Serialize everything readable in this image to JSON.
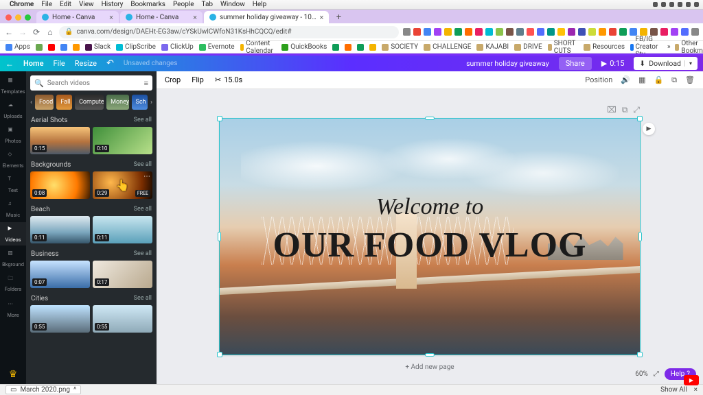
{
  "mac_menu": {
    "app": "Chrome",
    "items": [
      "File",
      "Edit",
      "View",
      "History",
      "Bookmarks",
      "People",
      "Tab",
      "Window",
      "Help"
    ]
  },
  "tabs": [
    {
      "title": "Home - Canva"
    },
    {
      "title": "Home - Canva"
    },
    {
      "title": "summer holiday giveaway - 10…"
    }
  ],
  "omnibox": {
    "url": "canva.com/design/DAEHt-EG3aw/cYSkUwlCWfoN31KsHhCQCQ/edit#",
    "lock": "🔒"
  },
  "bookmarks": {
    "apps": "Apps",
    "items": [
      "Slack",
      "ClipScribe",
      "ClickUp",
      "Evernote",
      "Content Calendar",
      "QuickBooks",
      "SOCIETY",
      "CHALLENGE",
      "KAJABI",
      "DRIVE",
      "SHORT CUTS",
      "Resources",
      "FB/IG Creator Stu…"
    ],
    "other": "Other Bookmarks"
  },
  "canva_top": {
    "home": "Home",
    "file": "File",
    "resize": "Resize",
    "unsaved": "Unsaved changes",
    "doc_title": "summer holiday giveaway",
    "share": "Share",
    "play_time": "0:15",
    "download": "Download"
  },
  "rail": [
    "Templates",
    "Uploads",
    "Photos",
    "Elements",
    "Text",
    "Music",
    "Videos",
    "Bkground",
    "Folders",
    "More"
  ],
  "search": {
    "placeholder": "Search videos"
  },
  "chips": [
    "Food",
    "Fall",
    "Computer",
    "Money",
    "Sch"
  ],
  "sections": {
    "aerial": {
      "title": "Aerial Shots",
      "all": "See all",
      "d1": "0:15",
      "d2": "0:10"
    },
    "backgrounds": {
      "title": "Backgrounds",
      "all": "See all",
      "d1": "0:08",
      "d2": "0:29",
      "free": "FREE"
    },
    "beach": {
      "title": "Beach",
      "all": "See all",
      "d1": "0:11",
      "d2": "0:11"
    },
    "business": {
      "title": "Business",
      "all": "See all",
      "d1": "0:07",
      "d2": "0:17"
    },
    "cities": {
      "title": "Cities",
      "all": "See all",
      "d1": "0:55",
      "d2": "0:55"
    }
  },
  "context_bar": {
    "crop": "Crop",
    "flip": "Flip",
    "duration": "15.0s",
    "position": "Position"
  },
  "canvas_text": {
    "line1": "Welcome to",
    "line2": "OUR FOOD VLOG"
  },
  "addpage": "+ Add new page",
  "zoom": {
    "pct": "60%"
  },
  "help": "Help",
  "download_bar": {
    "file": "March 2020.png",
    "showall": "Show All"
  }
}
